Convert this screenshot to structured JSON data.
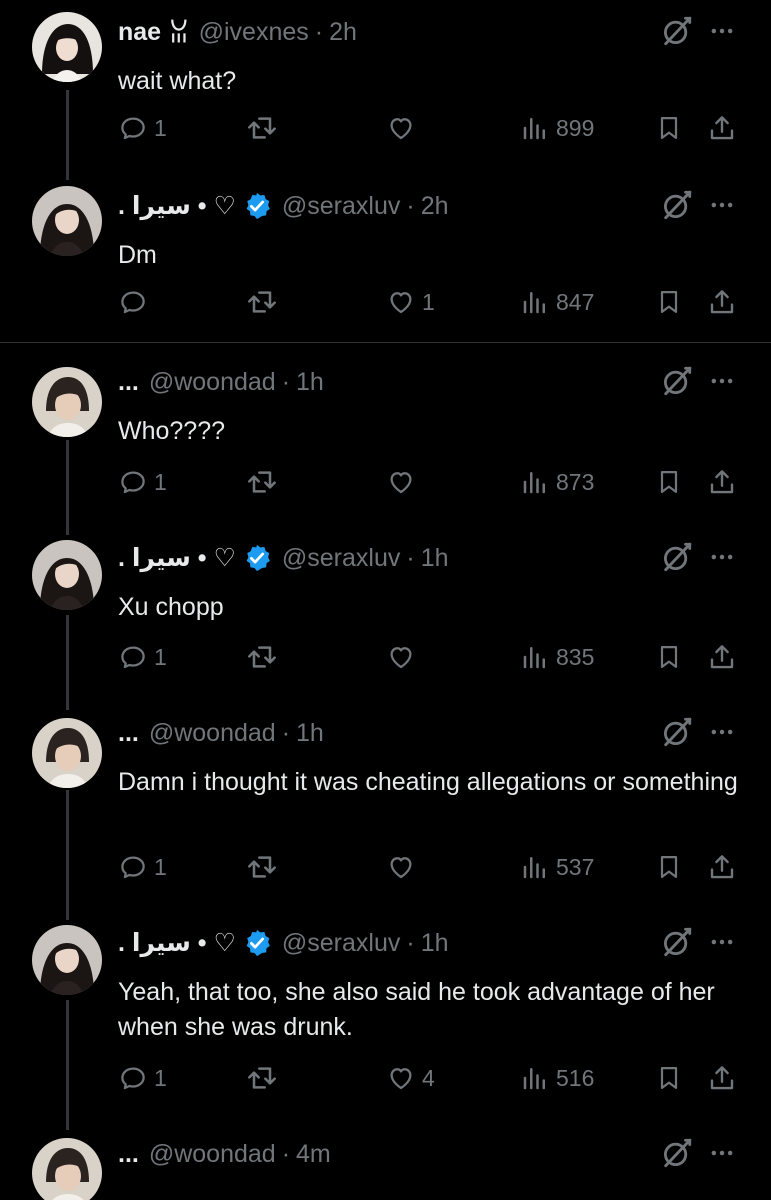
{
  "colors": {
    "background": "#000000",
    "text": "#e7e9ea",
    "muted": "#71767b",
    "verified": "#1d9bf0",
    "divider": "#2f3336"
  },
  "tweets": [
    {
      "name": "nae",
      "name_deco": "ꈍ",
      "handle": "@ivexnes",
      "time": "2h",
      "text": "wait what?",
      "replies": "1",
      "likes": "",
      "views": "899"
    },
    {
      "name": ". سيرا • ♡",
      "verified": true,
      "handle": "@seraxluv",
      "time": "2h",
      "text": "Dm",
      "replies": "",
      "likes": "1",
      "views": "847"
    },
    {
      "name": "...",
      "handle": "@woondad",
      "time": "1h",
      "text": "Who????",
      "replies": "1",
      "likes": "",
      "views": "873"
    },
    {
      "name": ". سيرا • ♡",
      "verified": true,
      "handle": "@seraxluv",
      "time": "1h",
      "text": "Xu chopp",
      "replies": "1",
      "likes": "",
      "views": "835"
    },
    {
      "name": "...",
      "handle": "@woondad",
      "time": "1h",
      "text": "Damn i thought it was cheating allegations or something",
      "replies": "1",
      "likes": "",
      "views": "537"
    },
    {
      "name": ". سيرا • ♡",
      "verified": true,
      "handle": "@seraxluv",
      "time": "1h",
      "text": "Yeah, that too, she also said he took advantage of her when she was drunk.",
      "replies": "1",
      "likes": "4",
      "views": "516"
    },
    {
      "name": "...",
      "handle": "@woondad",
      "time": "4m"
    }
  ],
  "icons": {
    "reply": "reply-icon",
    "retweet": "retweet-icon",
    "like": "heart-icon",
    "views": "views-icon",
    "bookmark": "bookmark-icon",
    "share": "share-icon",
    "grok": "grok-icon",
    "more": "more-icon",
    "verified": "verified-badge-icon"
  }
}
